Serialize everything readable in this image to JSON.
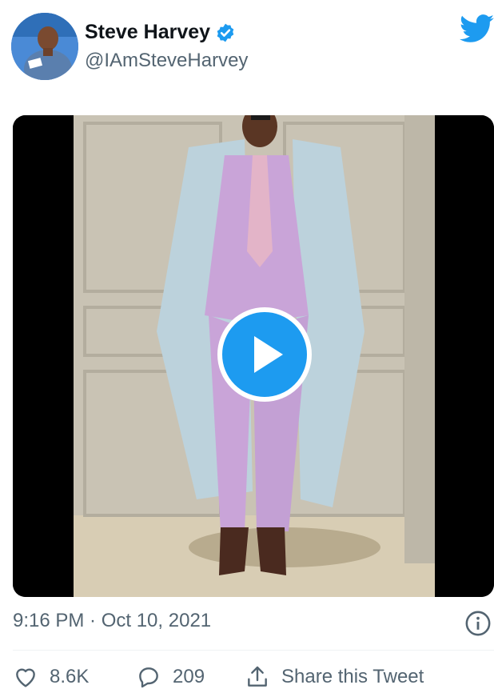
{
  "tweet": {
    "author_name": "Steve Harvey",
    "author_handle": "@IAmSteveHarvey",
    "timestamp": "9:16 PM · Oct 10, 2021"
  },
  "actions": {
    "likes": "8.6K",
    "replies": "209",
    "share_label": "Share this Tweet"
  },
  "icons": [
    "verified-badge-icon",
    "twitter-bird-icon",
    "play-icon",
    "info-icon",
    "heart-icon",
    "reply-icon",
    "share-icon"
  ],
  "colors": {
    "accent": "#1d9bf0",
    "text": "#0f1419",
    "muted": "#536471"
  }
}
